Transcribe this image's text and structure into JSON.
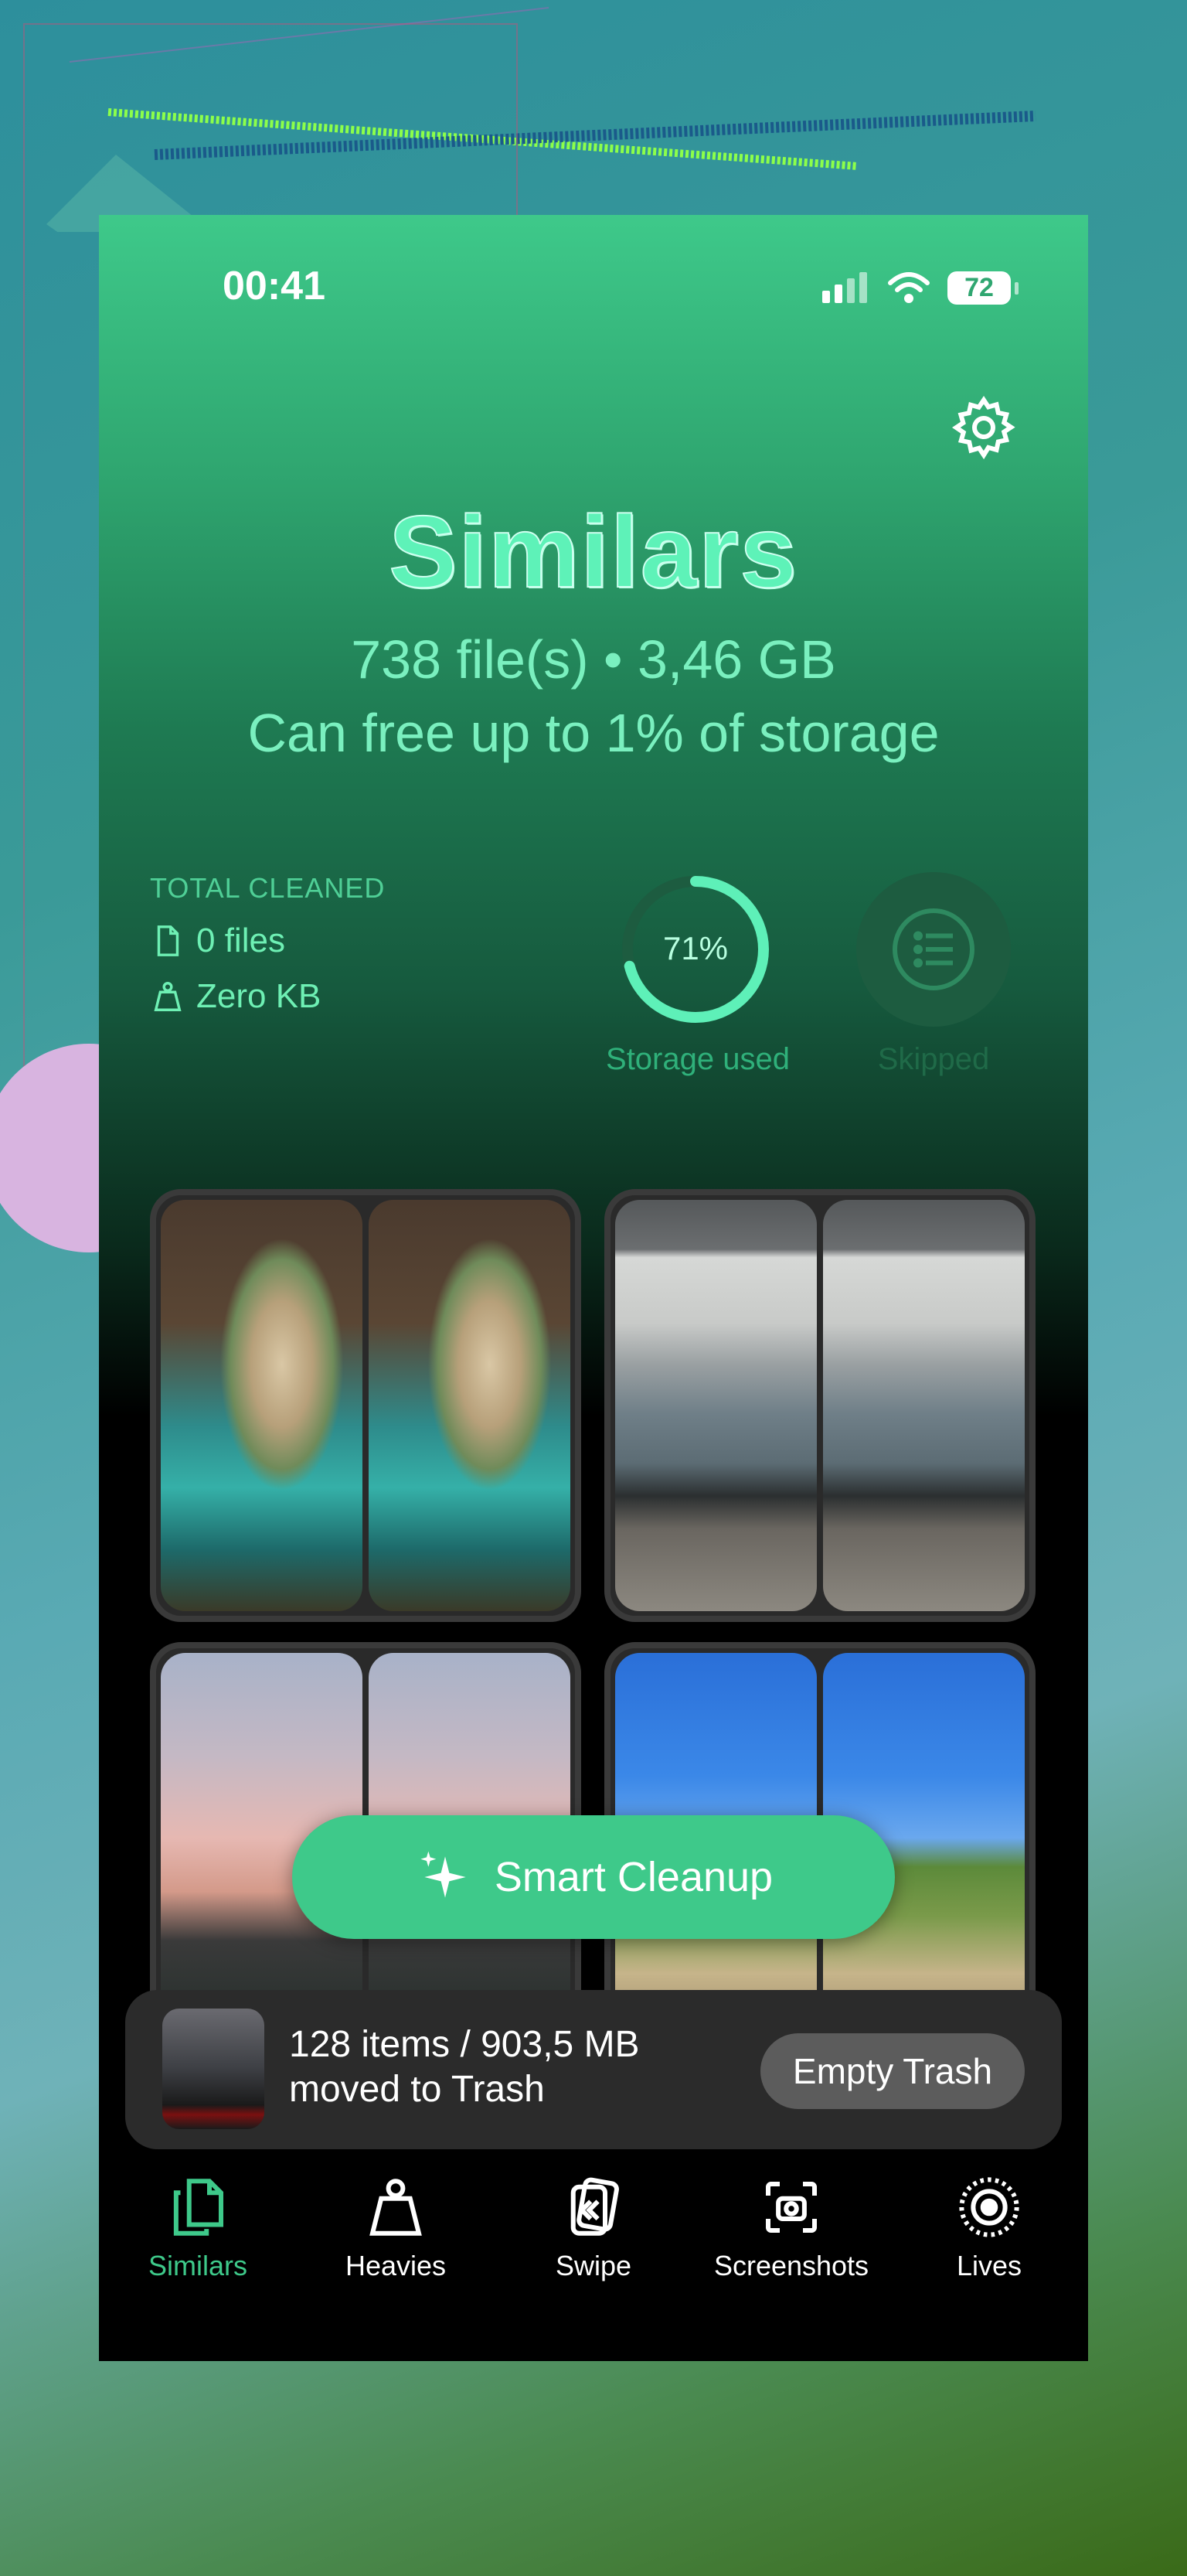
{
  "status_bar": {
    "time": "00:41",
    "battery": "72"
  },
  "header": {
    "title": "Similars",
    "summary": "738 file(s) • 3,46 GB",
    "free_up": "Can free up to 1% of storage"
  },
  "stats": {
    "total_cleaned_label": "TOTAL CLEANED",
    "files": "0 files",
    "size": "Zero KB",
    "storage_percent_text": "71%",
    "storage_fraction": 0.71,
    "storage_label": "Storage used",
    "skipped_label": "Skipped"
  },
  "smart_cleanup": {
    "label": "Smart Cleanup"
  },
  "trash": {
    "line1": "128 items / 903,5 MB",
    "line2": "moved to Trash",
    "button": "Empty Trash"
  },
  "tabs": [
    {
      "label": "Similars",
      "icon": "copy-icon"
    },
    {
      "label": "Heavies",
      "icon": "weight-icon"
    },
    {
      "label": "Swipe",
      "icon": "swipe-cards-icon"
    },
    {
      "label": "Screenshots",
      "icon": "screenshot-icon"
    },
    {
      "label": "Lives",
      "icon": "live-photo-icon"
    }
  ],
  "colors": {
    "accent": "#3ec98a",
    "accent_text": "#7af0bf",
    "background_dark": "#000000"
  }
}
